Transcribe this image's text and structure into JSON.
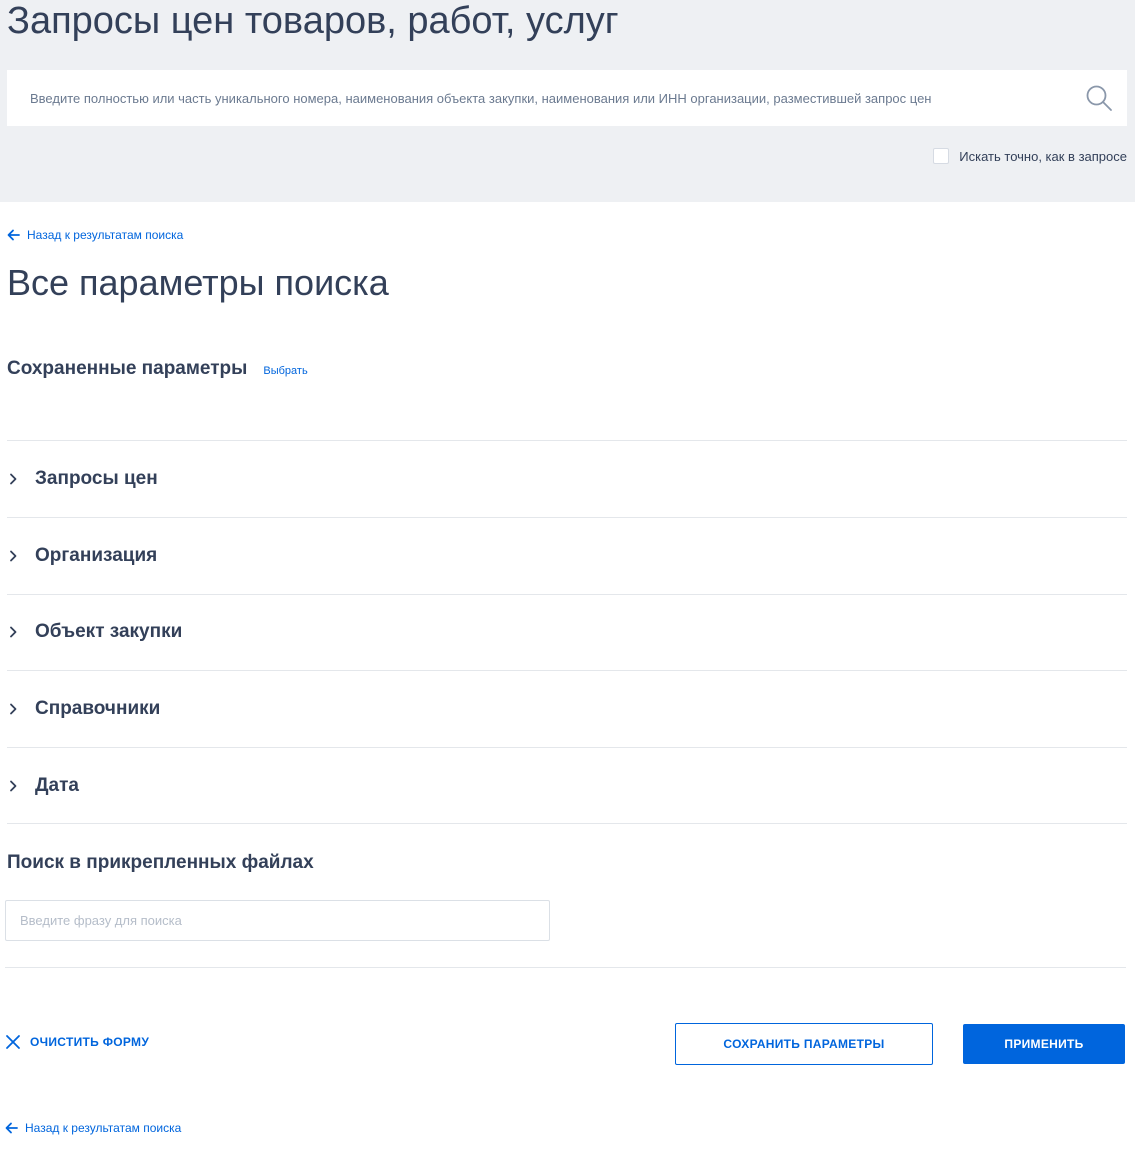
{
  "header": {
    "title": "Запросы цен товаров, работ, услуг",
    "search_placeholder": "Введите полностью или часть уникального номера, наименования объекта закупки, наименования или ИНН организации, разместившей запрос цен",
    "exact_match_label": "Искать точно, как в запросе",
    "exact_match_checked": false
  },
  "back_link_label": "Назад к результатам поиска",
  "main": {
    "title": "Все параметры поиска",
    "saved_params": {
      "label": "Сохраненные параметры",
      "choose_label": "Выбрать"
    },
    "sections": [
      {
        "label": "Запросы цен"
      },
      {
        "label": "Организация"
      },
      {
        "label": "Объект закупки"
      },
      {
        "label": "Справочники"
      },
      {
        "label": "Дата"
      }
    ],
    "files_search": {
      "title": "Поиск в прикрепленных файлах",
      "placeholder": "Введите фразу для поиска"
    }
  },
  "actions": {
    "clear_label": "ОЧИСТИТЬ ФОРМУ",
    "save_label": "СОХРАНИТЬ ПАРАМЕТРЫ",
    "apply_label": "ПРИМЕНИТЬ"
  },
  "colors": {
    "accent": "#0065dd",
    "text": "#334059",
    "header_bg": "#eef0f3"
  }
}
